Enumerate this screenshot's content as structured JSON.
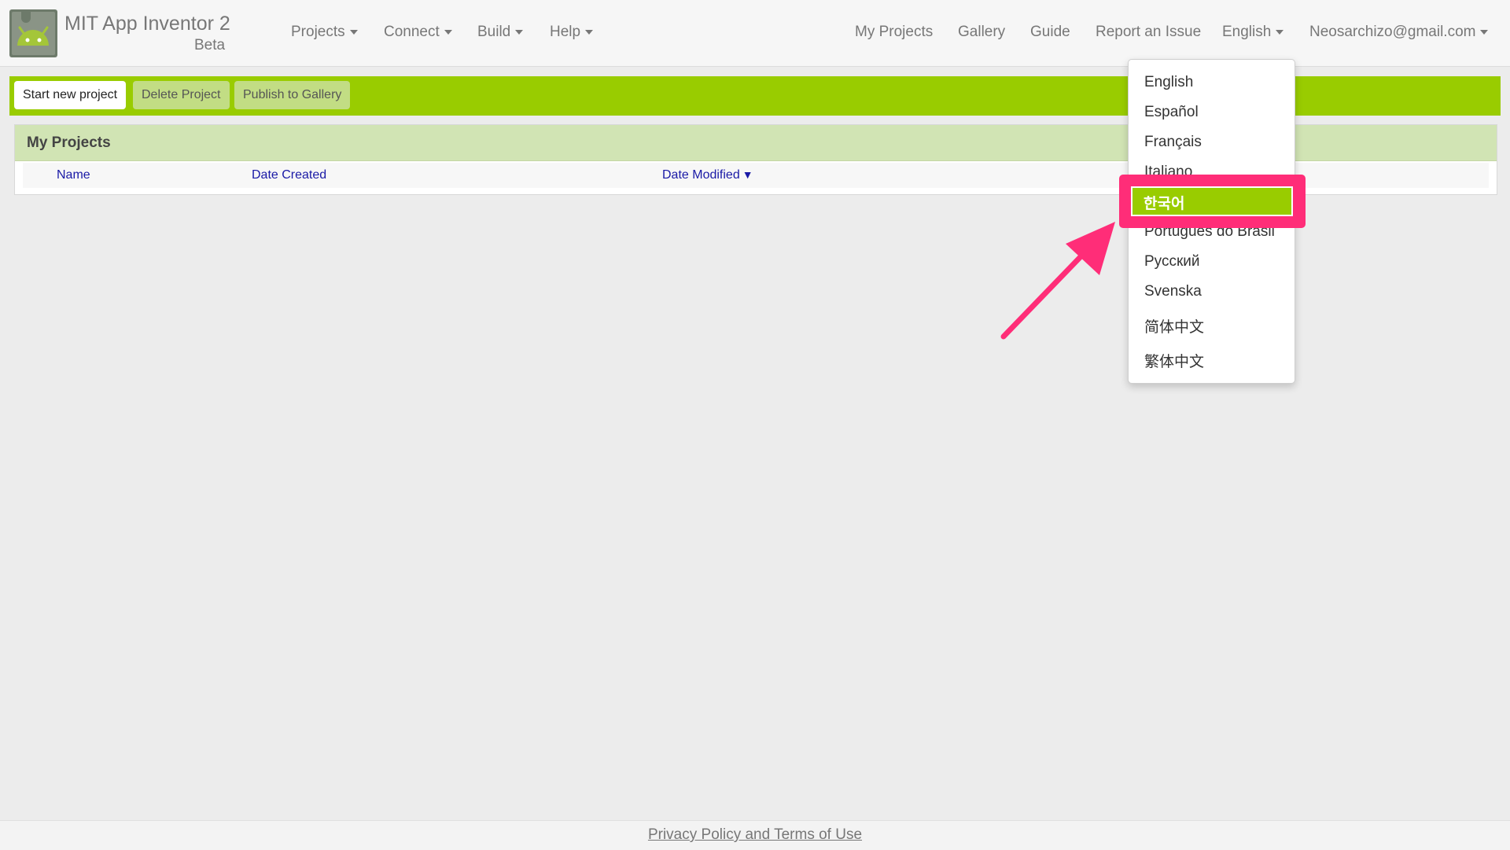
{
  "brand": {
    "title": "MIT App Inventor 2",
    "subtitle": "Beta"
  },
  "nav_left": [
    "Projects",
    "Connect",
    "Build",
    "Help"
  ],
  "nav_right": {
    "my_projects": "My Projects",
    "gallery": "Gallery",
    "guide": "Guide",
    "report": "Report an Issue",
    "language": "English",
    "account": "Neosarchizo@gmail.com"
  },
  "toolbar": {
    "start": "Start new project",
    "delete": "Delete Project",
    "publish": "Publish to Gallery"
  },
  "projects_panel": {
    "title": "My Projects",
    "columns": {
      "name": "Name",
      "date_created": "Date Created",
      "date_modified": "Date Modified",
      "sort_indicator": "▼"
    }
  },
  "language_menu": {
    "items": [
      "English",
      "Español",
      "Français",
      "Italiano",
      "한국어",
      "Português do Brasil",
      "Русский",
      "Svenska",
      "简体中文",
      "繁体中文"
    ],
    "highlighted": "한국어"
  },
  "footer": {
    "link": "Privacy Policy and Terms of Use"
  },
  "colors": {
    "accent_green": "#99cc00",
    "annotation_pink": "#ff2d78",
    "link_blue": "#1a1aa6"
  }
}
